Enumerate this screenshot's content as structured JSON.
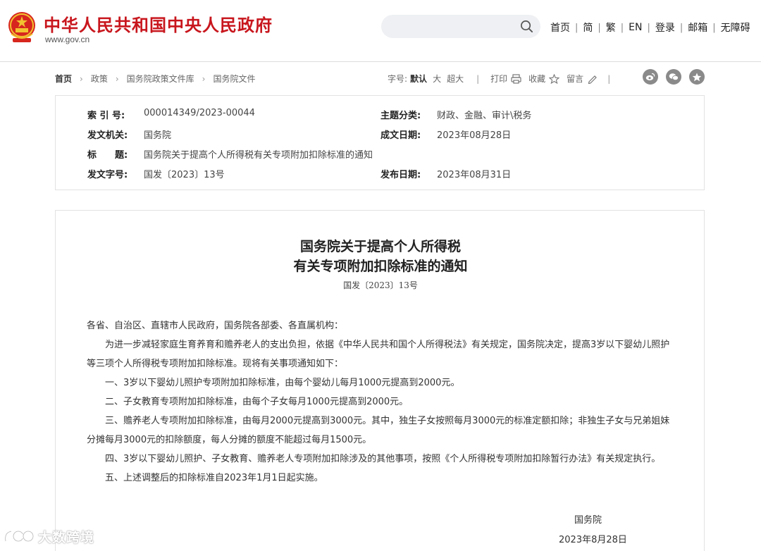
{
  "header": {
    "site_title": "中华人民共和国中央人民政府",
    "site_url": "www.gov.cn",
    "search": {
      "placeholder": ""
    },
    "nav": [
      "首页",
      "简",
      "繁",
      "EN",
      "登录",
      "邮箱",
      "无障碍"
    ]
  },
  "breadcrumb": [
    "首页",
    "政策",
    "国务院政策文件库",
    "国务院文件"
  ],
  "tools": {
    "font_label": "字号:",
    "font_default": "默认",
    "font_large": "大",
    "font_xlarge": "超大",
    "print": "打印",
    "favorite": "收藏",
    "comment": "留言"
  },
  "social": [
    "weibo-icon",
    "wechat-icon",
    "star-icon"
  ],
  "info": {
    "index_label": "索 引 号:",
    "index_value": "000014349/2023-00044",
    "category_label": "主题分类:",
    "category_value": "财政、金融、审计\\税务",
    "issuer_label": "发文机关:",
    "issuer_value": "国务院",
    "written_label": "成文日期:",
    "written_value": "2023年08月28日",
    "title_label": "标　　题:",
    "title_value": "国务院关于提高个人所得税有关专项附加扣除标准的通知",
    "docno_label": "发文字号:",
    "docno_value": "国发〔2023〕13号",
    "published_label": "发布日期:",
    "published_value": "2023年08月31日"
  },
  "article": {
    "title_line1": "国务院关于提高个人所得税",
    "title_line2": "有关专项附加扣除标准的通知",
    "doc_number": "国发〔2023〕13号",
    "salutation": "各省、自治区、直辖市人民政府，国务院各部委、各直属机构：",
    "paragraphs": [
      "为进一步减轻家庭生育养育和赡养老人的支出负担，依据《中华人民共和国个人所得税法》有关规定，国务院决定，提高3岁以下婴幼儿照护等三项个人所得税专项附加扣除标准。现将有关事项通知如下：",
      "一、3岁以下婴幼儿照护专项附加扣除标准，由每个婴幼儿每月1000元提高到2000元。",
      "二、子女教育专项附加扣除标准，由每个子女每月1000元提高到2000元。",
      "三、赡养老人专项附加扣除标准，由每月2000元提高到3000元。其中，独生子女按照每月3000元的标准定额扣除；非独生子女与兄弟姐妹分摊每月3000元的扣除额度，每人分摊的额度不能超过每月1500元。",
      "四、3岁以下婴幼儿照护、子女教育、赡养老人专项附加扣除涉及的其他事项，按照《个人所得税专项附加扣除暂行办法》有关规定执行。",
      "五、上述调整后的扣除标准自2023年1月1日起实施。"
    ],
    "signer": "国务院",
    "sign_date": "2023年8月28日"
  },
  "watermark": {
    "text": "大数跨境"
  }
}
